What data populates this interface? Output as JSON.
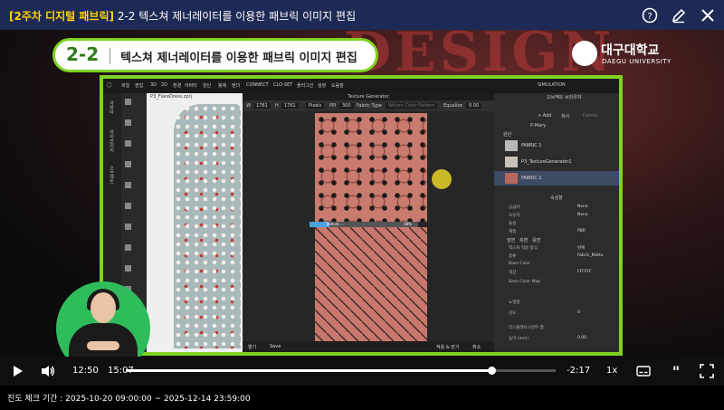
{
  "header": {
    "tag": "[2주차 디지털 패브릭]",
    "title": "2-2 텍스쳐 제너레이터를 이용한 패브릭 이미지 편집",
    "icons": [
      "help-icon",
      "edit-icon",
      "close-icon"
    ]
  },
  "video": {
    "lecture_number": "2-2",
    "lecture_title": "텍스쳐 제너레이터를 이용한 패브릭 이미지 편집",
    "university_kr": "대구대학교",
    "university_en": "DAEGU UNIVERSITY",
    "background_text": "DESIGN",
    "app": {
      "menu": [
        "파일",
        "편집",
        "3D",
        "2D",
        "환경",
        "아바타",
        "원단",
        "봉제",
        "렌더",
        "CONNECT",
        "CLO-SET",
        "플러그인",
        "설정",
        "도움말"
      ],
      "simulation_label": "SIMULATION",
      "viewport_file": "P3_FlareDress.zprj",
      "left_tabs": [
        "아바타",
        "라이브러리",
        "오브젝트"
      ],
      "texture_panel": {
        "title": "Texture Generator",
        "w_label": "W",
        "w_value": "1761",
        "h_label": "H",
        "h_value": "1761",
        "unit": "Pixels",
        "ppi_label": "PPI",
        "ppi_value": "300",
        "fabric_type_label": "Fabric Type",
        "fabric_type_value": "Woven Color Pattern",
        "equalize_label": "Equalize",
        "equalize_value": "0.00",
        "progress_label": "Texture ...",
        "progress_pct": "18%",
        "progress_fraction": 0.18,
        "open_label": "열기",
        "save_label": "Save",
        "apply_close_label": "적용 & 닫기",
        "cancel_label": "취소"
      },
      "object_browser": {
        "title": "오브젝트 브라우저",
        "add_label": "+ Add",
        "copy_label": "복사",
        "delete_label": "Delete",
        "primary_label": "P-Mary",
        "fabric_section": "원단",
        "fabrics": [
          {
            "name": "FABRIC 1",
            "selected": false
          },
          {
            "name": "P3_TextureGenerator1",
            "selected": false
          },
          {
            "name": "FABRIC 1",
            "selected": true
          }
        ]
      },
      "properties": {
        "title": "속성창",
        "rows": [
          {
            "k": "공급자",
            "v": "None"
          },
          {
            "k": "소유자",
            "v": "None"
          },
          {
            "k": "물성",
            "v": ""
          },
          {
            "k": "재질",
            "v": "PBR"
          },
          {
            "k": "텍스처 적용 방식",
            "v": "반복"
          },
          {
            "k": "종류",
            "v": "Fabric_Matte"
          },
          {
            "k": "Base Color",
            "v": ""
          },
          {
            "k": "색상",
            "v": "FFFFFF"
          },
          {
            "k": "Base Color Map",
            "v": ""
          },
          {
            "k": "노멀맵",
            "v": ""
          },
          {
            "k": "강도",
            "v": "0"
          },
          {
            "k": "디스플레이스먼트 맵",
            "v": ""
          },
          {
            "k": "높이 (mm)",
            "v": "0.00"
          }
        ],
        "tabs": [
          "앞면",
          "측면",
          "뒷면"
        ]
      }
    }
  },
  "player": {
    "current_time": "12:50",
    "duration": "15:07",
    "remaining": "-2:17",
    "speed": "1x",
    "progress_fraction": 0.85,
    "icons": [
      "play-icon",
      "volume-icon",
      "subtitle-icon",
      "quote-icon",
      "fullscreen-icon"
    ]
  },
  "footer": {
    "period_text": "진도 체크 기간 : 2025-10-20 09:00:00 ~ 2025-12-14 23:59:00"
  },
  "colors": {
    "header_bg": "#1d2a55",
    "tag_yellow": "#ffd400",
    "frame_green": "#7ed321",
    "signer_green": "#2fbd5c"
  }
}
